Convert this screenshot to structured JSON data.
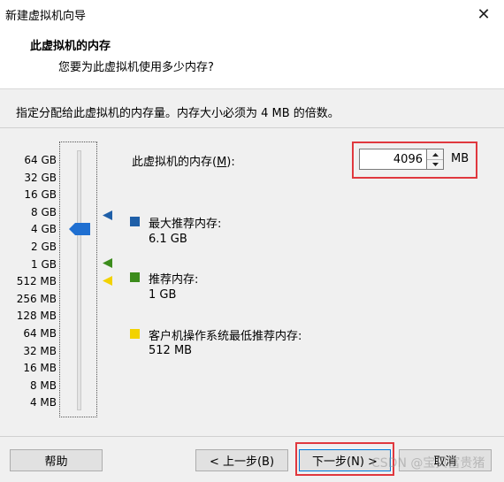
{
  "window": {
    "title": "新建虚拟机向导",
    "close_glyph": "✕"
  },
  "header": {
    "title": "此虚拟机的内存",
    "subtitle": "您要为此虚拟机使用多少内存?"
  },
  "instruction": "指定分配给此虚拟机的内存量。内存大小必须为 4 MB 的倍数。",
  "memory_scale": {
    "labels": [
      "64 GB",
      "32 GB",
      "16 GB",
      "8 GB",
      "4 GB",
      "2 GB",
      "1 GB",
      "512 MB",
      "256 MB",
      "128 MB",
      "64 MB",
      "32 MB",
      "16 MB",
      "8 MB",
      "4 MB"
    ]
  },
  "memory_field": {
    "label_prefix": "此虚拟机的内存(",
    "label_accel": "M",
    "label_suffix": "):",
    "value": "4096",
    "unit": "MB"
  },
  "legend": {
    "max_recommended": {
      "title": "最大推荐内存:",
      "value": "6.1 GB",
      "color": "#1f5fa8"
    },
    "recommended": {
      "title": "推荐内存:",
      "value": "1 GB",
      "color": "#3c8c1c"
    },
    "guest_min": {
      "title": "客户机操作系统最低推荐内存:",
      "value": "512 MB",
      "color": "#f2d200"
    }
  },
  "colors": {
    "thumb": "#1f6fd1",
    "highlight": "#e0383e"
  },
  "buttons": {
    "help": "帮助",
    "back": "< 上一步(B)",
    "next": "下一步(N) >",
    "cancel": "取消"
  },
  "watermark": "CSDN @宝贝富贵猪"
}
